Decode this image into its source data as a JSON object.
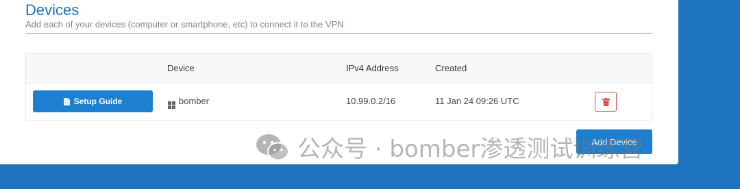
{
  "section": {
    "title": "Devices",
    "subtitle": "Add each of your devices (computer or smartphone, etc) to connect it to the VPN"
  },
  "table": {
    "columns": [
      "",
      "Device",
      "IPv4 Address",
      "Created",
      ""
    ],
    "rows": [
      {
        "setup_label": "Setup Guide",
        "device_icon": "windows-icon",
        "device": "bomber",
        "ipv4": "10.99.0.2/16",
        "created": "11 Jan 24 09:26 UTC",
        "delete_icon": "trash-icon"
      }
    ]
  },
  "actions": {
    "add_device_label": "Add Device"
  },
  "watermark": {
    "text": "公众号 · bomber渗透测试训练营",
    "icon": "wechat-icon"
  },
  "colors": {
    "brand_blue": "#1e73be",
    "button_blue": "#1e7fd0",
    "danger_red": "#d9534f",
    "header_bg": "#f7f8fa"
  }
}
